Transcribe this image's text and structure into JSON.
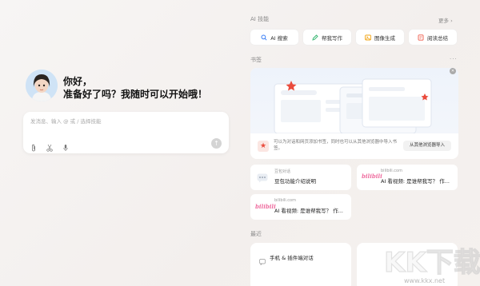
{
  "greeting": {
    "line1": "你好，",
    "line2": "准备好了吗？我随时可以开始哦！"
  },
  "chat": {
    "placeholder": "发消息、输入 @ 或 / 选择技能",
    "tool_icons": [
      "paperclip-icon",
      "scissors-icon",
      "microphone-icon"
    ],
    "send_icon": "arrow-up-icon"
  },
  "skills": {
    "title": "AI 技能",
    "more": "更多 ›",
    "items": [
      {
        "label": "AI 搜索",
        "icon": "search-icon",
        "color": "#3b7ff5"
      },
      {
        "label": "帮我写作",
        "icon": "pen-icon",
        "color": "#2db36a"
      },
      {
        "label": "图像生成",
        "icon": "image-icon",
        "color": "#f2a516"
      },
      {
        "label": "阅读总结",
        "icon": "book-icon",
        "color": "#ef5b4a"
      }
    ]
  },
  "bookmarks": {
    "title": "书签",
    "more": "···",
    "description": "可以为对话和网页添加书签，同时也可以从其他浏览器中导入书签。",
    "import_button": "从其他浏览器导入",
    "items": [
      {
        "source": "豆包对话",
        "title": "豆包功能介绍说明",
        "icon": "chat-bubble-icon"
      },
      {
        "source": "bilibili.com",
        "title": "AI 看视频: 是谁帮我写？ 作...",
        "icon": "bilibili-logo"
      },
      {
        "source": "bilibili.com",
        "title": "AI 看视频: 是谁帮我写？ 作...",
        "icon": "bilibili-logo"
      }
    ],
    "logo_text": "bilibili"
  },
  "recent": {
    "title": "最近",
    "items": [
      {
        "label": "手机 & 插件端对话",
        "icon": "chat-bubble-icon"
      }
    ]
  },
  "watermark": {
    "logo": "KK下载",
    "url": "www.kkx.net"
  }
}
